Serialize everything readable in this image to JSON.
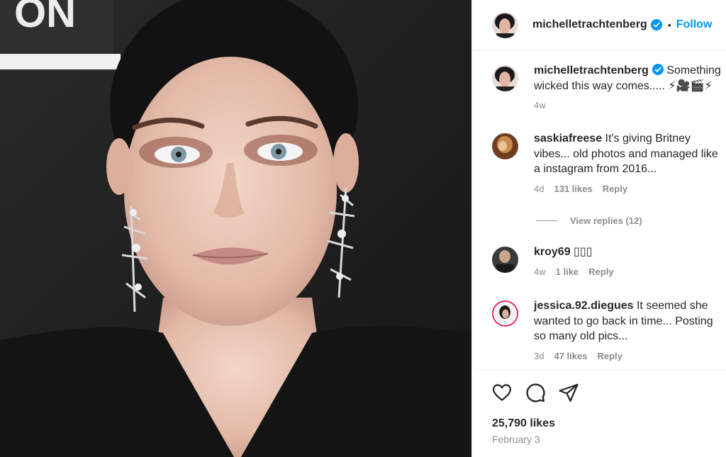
{
  "photo": {
    "alt_icon": "portrait-photo"
  },
  "post": {
    "author": "michelletrachtenberg",
    "separator": "•",
    "follow_label": "Follow",
    "caption_author": "michelletrachtenberg",
    "caption_text": "Something wicked this way comes..... ⚡🎥🎬⚡",
    "caption_time": "4w"
  },
  "comments": [
    {
      "user": "saskiafreese",
      "text": "It's giving Britney vibes... old photos and managed like a instagram from 2016...",
      "time": "4d",
      "likes": "131 likes",
      "reply": "Reply"
    },
    {
      "user": "kroy69",
      "text": "▯▯▯",
      "time": "4w",
      "likes": "1 like",
      "reply": "Reply"
    },
    {
      "user": "jessica.92.diegues",
      "text": "It seemed she wanted to go back in time... Posting so many old pics...",
      "time": "3d",
      "likes": "47 likes",
      "reply": "Reply"
    }
  ],
  "view_replies": "View replies (12)",
  "footer": {
    "likes": "25,790 likes",
    "date": "February 3"
  },
  "colors": {
    "accent": "#0095f6",
    "verified": "#0095f6",
    "text": "#262626",
    "muted": "#8e8e8e"
  },
  "icons": [
    "heart-icon",
    "comment-icon",
    "share-icon",
    "verified-badge-icon"
  ]
}
